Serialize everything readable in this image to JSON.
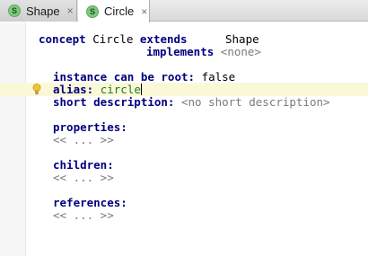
{
  "tabs": [
    {
      "badge": "S",
      "label": "Shape",
      "close": "×"
    },
    {
      "badge": "S",
      "label": "Circle",
      "close": "×"
    }
  ],
  "editor": {
    "decl_keyword": "concept",
    "concept_name": "Circle",
    "extends_keyword": "extends",
    "extends_value": "Shape",
    "implements_keyword": "implements",
    "implements_value": "<none>",
    "root_label": "instance can be root:",
    "root_value": "false",
    "alias_label": "alias:",
    "alias_value": "circle",
    "short_desc_label": "short description:",
    "short_desc_value": "<no short description>",
    "properties_label": "properties:",
    "properties_value": "<< ... >>",
    "children_label": "children:",
    "children_value": "<< ... >>",
    "references_label": "references:",
    "references_value": "<< ... >>"
  },
  "colors": {
    "keyword": "#000080",
    "reference": "#1f7a1f",
    "placeholder": "#7a7a7a",
    "caret_row": "#fbf8d8",
    "badge": "#7fc97f"
  },
  "icons": [
    "concept-badge-icon",
    "close-icon",
    "intention-bulb-icon"
  ]
}
